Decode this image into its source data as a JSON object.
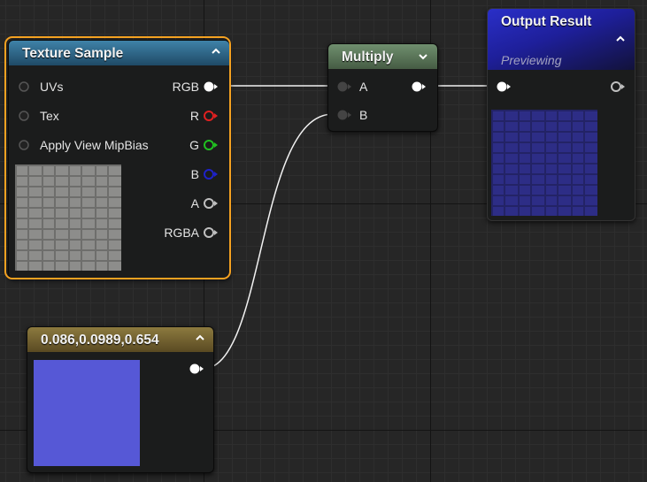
{
  "texture_sample": {
    "title": "Texture Sample",
    "inputs": [
      "UVs",
      "Tex",
      "Apply View MipBias"
    ],
    "outputs": [
      {
        "label": "RGB",
        "color": "#ffffff"
      },
      {
        "label": "R",
        "color": "#e02020"
      },
      {
        "label": "G",
        "color": "#20c020"
      },
      {
        "label": "B",
        "color": "#1e22c8"
      },
      {
        "label": "A",
        "color": "#bfbfbf"
      },
      {
        "label": "RGBA",
        "color": "#bfbfbf"
      }
    ],
    "collapse_icon": "chevron-up-icon",
    "selection_color": "#f4a121"
  },
  "multiply": {
    "title": "Multiply",
    "inputs": [
      "A",
      "B"
    ],
    "collapse_icon": "chevron-down-icon"
  },
  "output_result": {
    "title": "Output Result",
    "subtitle": "Previewing",
    "collapse_icon": "chevron-up-icon"
  },
  "constant_vector": {
    "title": "0.086,0.0989,0.654",
    "color": "#5658d6",
    "collapse_icon": "chevron-up-icon"
  },
  "colors": {
    "grid_background": "#262626",
    "texture_header": "#3f82a8",
    "multiply_header": "#6f8f6e",
    "vector_header": "#8c7a3f",
    "output_header": "#2a2fc8",
    "wire": "#f2f2f2"
  }
}
